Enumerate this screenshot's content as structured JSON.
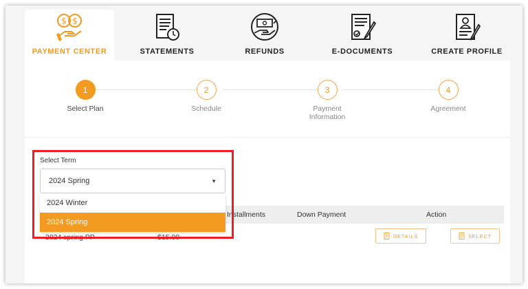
{
  "colors": {
    "accent": "#f39a21",
    "highlight": "#ee1c24",
    "header_bg": "#eeeeee"
  },
  "tabs": [
    {
      "label": "PAYMENT CENTER",
      "icon": "payment-center-icon",
      "active": true
    },
    {
      "label": "STATEMENTS",
      "icon": "statements-icon"
    },
    {
      "label": "REFUNDS",
      "icon": "refunds-icon"
    },
    {
      "label": "E-DOCUMENTS",
      "icon": "e-documents-icon"
    },
    {
      "label": "CREATE PROFILE",
      "icon": "create-profile-icon"
    }
  ],
  "steps": [
    {
      "number": "1",
      "label": "Select Plan",
      "active": true
    },
    {
      "number": "2",
      "label": "Schedule"
    },
    {
      "number": "3",
      "label": "Payment\nInformation"
    },
    {
      "number": "4",
      "label": "Agreement"
    }
  ],
  "term": {
    "label": "Select Term",
    "selected": "2024 Spring",
    "options": [
      "2024 Winter",
      "2024 Spring"
    ]
  },
  "table": {
    "headers": {
      "installments": "Installments",
      "down_payment": "Down Payment",
      "action": "Action"
    },
    "rows": [
      {
        "name": "2024 spring PP",
        "amount": "$15.00"
      }
    ]
  },
  "buttons": {
    "details": "DETAILS",
    "select": "SELECT"
  }
}
